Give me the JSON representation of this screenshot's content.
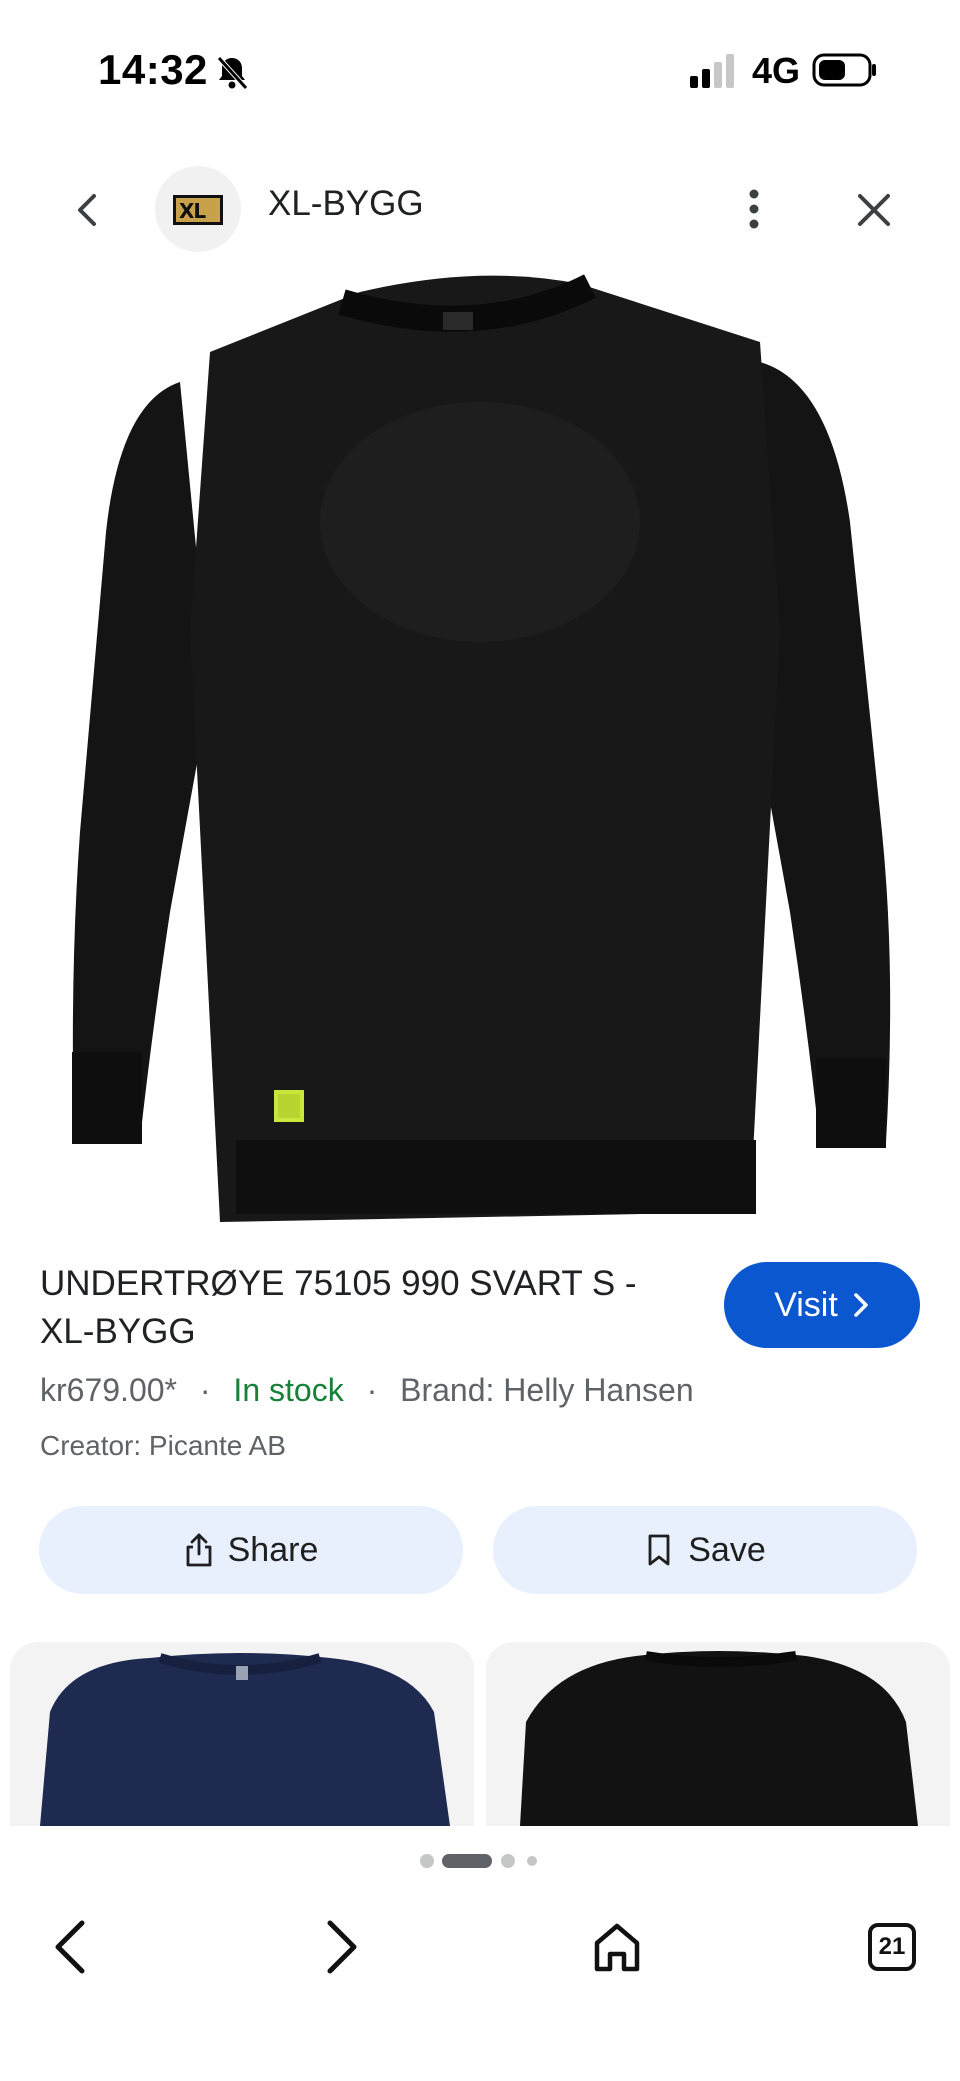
{
  "status_bar": {
    "time": "14:32",
    "network": "4G",
    "icons": [
      "bell-slash-icon",
      "signal-icon",
      "battery-icon"
    ]
  },
  "header": {
    "logo_text": "XL",
    "site_name": "XL-BYGG",
    "icons": [
      "chevron-left-icon",
      "more-vertical-icon",
      "close-icon"
    ]
  },
  "product": {
    "title": "UNDERTRØYE 75105 990 SVART S - XL-BYGG",
    "price": "kr679.00*",
    "separator": "·",
    "stock": "In stock",
    "brand": "Brand: Helly Hansen",
    "creator": "Creator: Picante AB",
    "stock_color": "#188038"
  },
  "actions": {
    "visit_label": "Visit",
    "share_label": "Share",
    "save_label": "Save",
    "visit_color": "#0b57d0",
    "button_bg": "#e8effd"
  },
  "pagination": {
    "total": 4,
    "active": 2
  },
  "bottom_nav": {
    "tab_count": "21",
    "icons": [
      "back-arrow-icon",
      "forward-arrow-icon",
      "home-icon",
      "tabs-icon"
    ]
  }
}
